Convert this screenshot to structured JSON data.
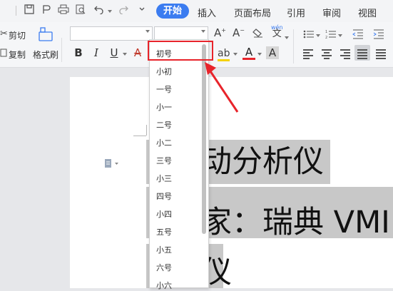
{
  "tabs": {
    "start": "开始",
    "insert": "插入",
    "layout": "页面布局",
    "references": "引用",
    "review": "审阅",
    "view": "视图"
  },
  "ribbon": {
    "cut_label": "剪切",
    "copy_label": "复制",
    "format_painter_label": "格式刷",
    "bold": "B",
    "italic": "I",
    "underline": "U",
    "strike": "A",
    "font_color": "A",
    "char_shading": "A",
    "pinyin_top": "wén",
    "pinyin_bottom": "文",
    "font_size_value": "初号"
  },
  "font_size_dropdown": {
    "items": [
      "小初",
      "一号",
      "小一",
      "二号",
      "小二",
      "三号",
      "小三",
      "四号",
      "小四",
      "五号",
      "小五",
      "六号",
      "小六"
    ]
  },
  "document": {
    "line1": "动分析仪",
    "line2": "家：瑞典 VMI",
    "line3": "仪"
  },
  "colors": {
    "accent": "#3b7cf0",
    "annotation_red": "#e8242b"
  }
}
